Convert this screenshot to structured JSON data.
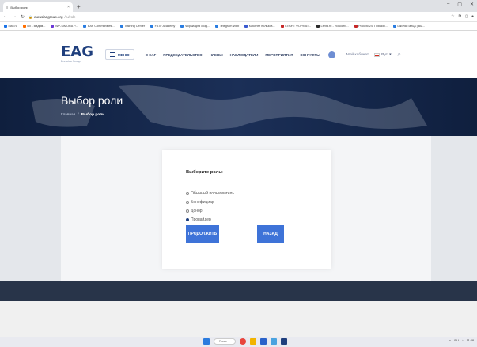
{
  "browser": {
    "tab_title": "Выбор роли",
    "url_host": "eurasiangroup.org",
    "url_path": "/ru/role",
    "bookmarks": [
      {
        "label": "Mail.ru",
        "color": "#1a73e8"
      },
      {
        "label": "ВХ - Вадим...",
        "color": "#ff6f00"
      },
      {
        "label": "WP-SIMORA P...",
        "color": "#6b38d6"
      },
      {
        "label": "EAF Communities...",
        "color": "#2a7de1"
      },
      {
        "label": "Training Center",
        "color": "#2a7de1"
      },
      {
        "label": "FATF Academy",
        "color": "#2a7de1"
      },
      {
        "label": "Форма для созд...",
        "color": "#2a7de1"
      },
      {
        "label": "Telegram Web",
        "color": "#2a7de1"
      },
      {
        "label": "Кабинет пользов...",
        "color": "#3a5ad0"
      },
      {
        "label": "СПОРТ ФОРМАТ...",
        "color": "#c62828"
      },
      {
        "label": "Lenta.ru - Новости...",
        "color": "#2b2b2b"
      },
      {
        "label": "Россия 24. Прямой...",
        "color": "#c62828"
      },
      {
        "label": "Школа Танца | Вы...",
        "color": "#2a7de1"
      }
    ]
  },
  "site": {
    "logo": "EAG",
    "logo_sub": "Eurasian Group",
    "menu_label": "МЕНЮ",
    "nav": [
      "О ЕАГ",
      "ПРЕДСЕДАТЕЛЬСТВО",
      "ЧЛЕНЫ",
      "НАБЛЮДАТЕЛИ",
      "МЕРОПРИЯТИЯ",
      "КОНТАКТЫ"
    ],
    "cabinet": "Мой кабинет",
    "lang": "Рус"
  },
  "hero": {
    "title": "Выбор роли",
    "crumb_home": "Главная",
    "crumb_sep": "/",
    "crumb_current": "Выбор роли"
  },
  "form": {
    "heading": "Выберите роль:",
    "options": [
      {
        "label": "Обычный пользователь",
        "selected": false
      },
      {
        "label": "Бенефициар",
        "selected": false
      },
      {
        "label": "Донор",
        "selected": false
      },
      {
        "label": "Провайдер",
        "selected": true
      }
    ],
    "continue_label": "ПРОДОЛЖИТЬ",
    "back_label": "НАЗАД"
  },
  "taskbar": {
    "search_placeholder": "Поиск",
    "tray": "RU",
    "time": "11:28"
  },
  "colors": {
    "brand": "#1f3f7d",
    "button": "#3e73d8",
    "hero": "#15284b"
  }
}
